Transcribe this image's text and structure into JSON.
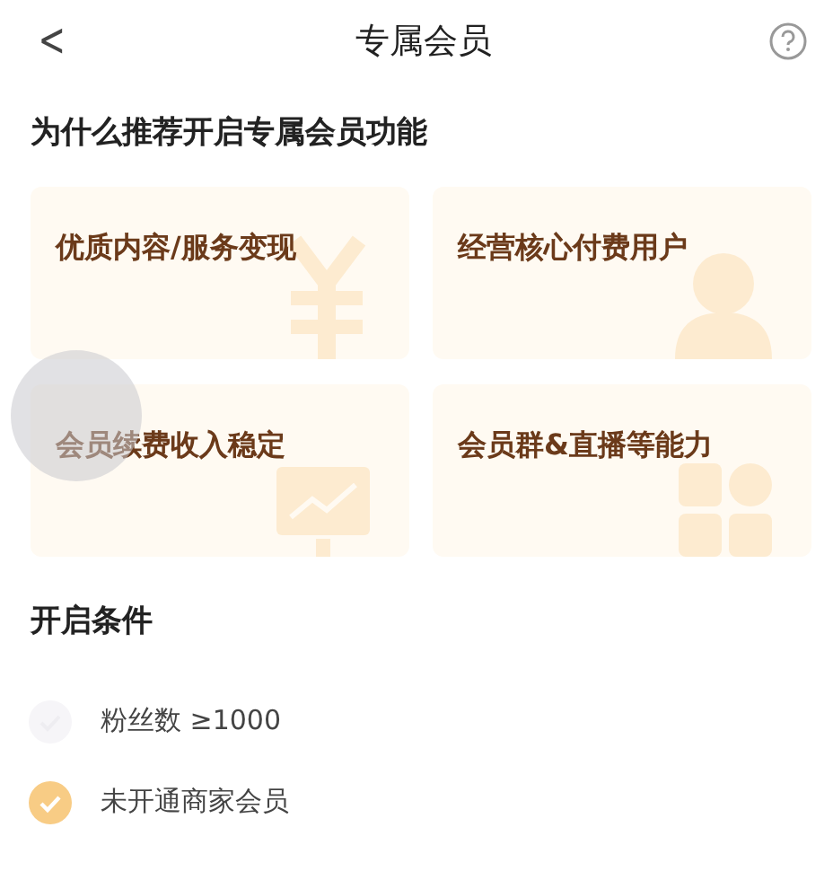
{
  "header": {
    "back": "<",
    "title": "专属会员"
  },
  "why": {
    "title": "为什么推荐开启专属会员功能",
    "cards": [
      {
        "label": "优质内容/服务变现",
        "kind": "yen"
      },
      {
        "label": "经营核心付费用户",
        "kind": "person"
      },
      {
        "label": "会员续费收入稳定",
        "kind": "chart"
      },
      {
        "label": "会员群&直播等能力",
        "kind": "grid"
      }
    ]
  },
  "conditions": {
    "title": "开启条件",
    "items": [
      {
        "label": "粉丝数 ≥1000",
        "checked": false
      },
      {
        "label": "未开通商家会员",
        "checked": true
      }
    ]
  }
}
